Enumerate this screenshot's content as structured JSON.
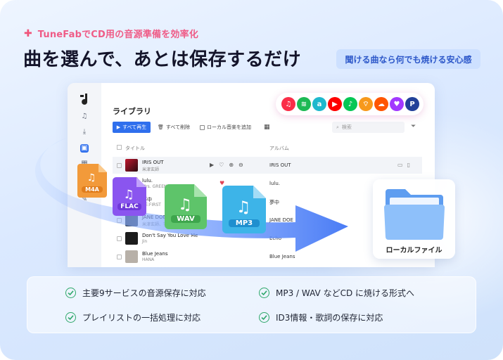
{
  "header": {
    "subtitle": "TuneFabでCD用の音源準備を効率化",
    "headline": "曲を選んで、あとは保存するだけ",
    "pill": "聞ける曲なら何でも焼ける安心感"
  },
  "app": {
    "library_title": "ライブラリ",
    "toolbar": {
      "play_all": "すべて再生",
      "delete_all": "すべて削除",
      "add_local": "ローカル音楽を追加",
      "search_placeholder": "検索"
    },
    "columns": {
      "title": "タイトル",
      "album": "アルバム"
    },
    "rows": [
      {
        "title": "IRIS OUT",
        "artist": "米津玄師",
        "album": "IRIS OUT"
      },
      {
        "title": "lulu.",
        "artist": "Mrs. GREEN APPLE",
        "album": "lulu."
      },
      {
        "title": "夢中",
        "artist": "BE:FIRST",
        "album": "夢中"
      },
      {
        "title": "JANE DOE",
        "artist": "米津玄師、宇多田ヒカル",
        "album": "JANE DOE"
      },
      {
        "title": "Don't Say You Love Me",
        "artist": "Jin",
        "album": "Echo"
      },
      {
        "title": "Blue Jeans",
        "artist": "HANA",
        "album": "Blue Jeans"
      }
    ]
  },
  "services": [
    {
      "name": "apple-music",
      "color": "#fa2d48",
      "glyph": "♫"
    },
    {
      "name": "spotify",
      "color": "#1db954",
      "glyph": "≋"
    },
    {
      "name": "amazon-music",
      "color": "#1fb8cd",
      "glyph": "a"
    },
    {
      "name": "youtube-music",
      "color": "#ff0000",
      "glyph": "▶"
    },
    {
      "name": "line-music",
      "color": "#06c755",
      "glyph": "♪"
    },
    {
      "name": "audible",
      "color": "#f7991c",
      "glyph": "⌔"
    },
    {
      "name": "soundcloud",
      "color": "#ff5500",
      "glyph": "☁"
    },
    {
      "name": "deezer",
      "color": "#a238ff",
      "glyph": "♥"
    },
    {
      "name": "pandora",
      "color": "#224099",
      "glyph": "P"
    }
  ],
  "formats": [
    "M4A",
    "FLAC",
    "WAV",
    "MP3"
  ],
  "destination": "ローカルファイル",
  "features": [
    "主要9サービスの音源保存に対応",
    "MP3 / WAV などCD に焼ける形式へ",
    "プレイリストの一括処理に対応",
    "ID3情報・歌詞の保存に対応"
  ],
  "colors": {
    "accent": "#2f6fed",
    "pink": "#ef5b86",
    "check": "#2fa86b"
  }
}
